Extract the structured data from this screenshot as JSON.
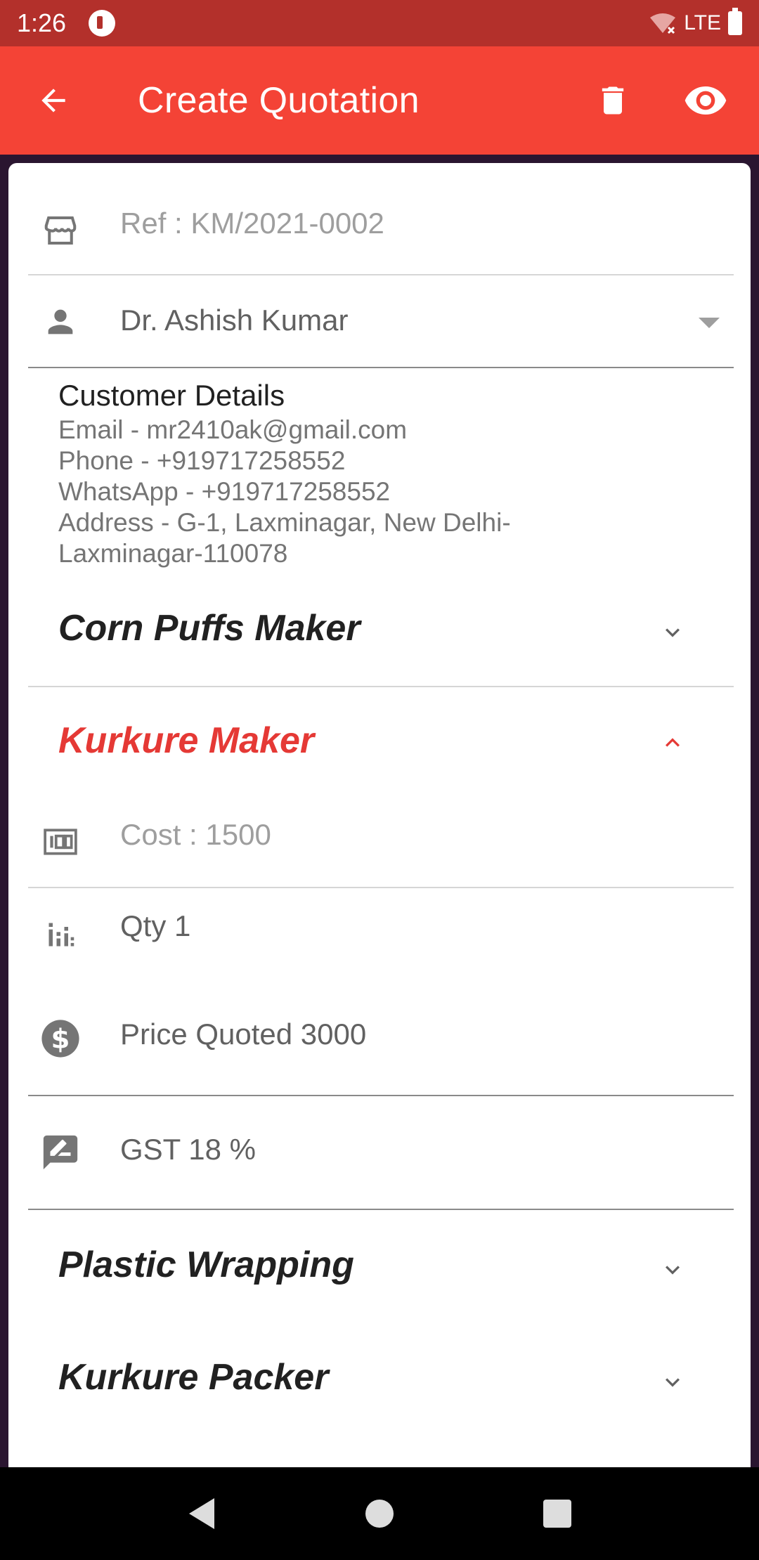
{
  "status_bar": {
    "time": "1:26",
    "network": "LTE"
  },
  "app_bar": {
    "title": "Create Quotation"
  },
  "form": {
    "ref": "Ref : KM/2021-0002",
    "customer_select": "Dr. Ashish Kumar"
  },
  "customer": {
    "title": "Customer Details",
    "email": "Email - mr2410ak@gmail.com",
    "phone": "Phone - +919717258552",
    "whatsapp": "WhatsApp - +919717258552",
    "address_line1": "Address - G-1, Laxminagar, New Delhi-",
    "address_line2": "Laxminagar-110078"
  },
  "items": [
    {
      "name": "Corn Puffs Maker",
      "expanded": false
    },
    {
      "name": "Kurkure Maker",
      "expanded": true,
      "cost": "Cost : 1500",
      "qty": "Qty 1",
      "price": "Price Quoted 3000",
      "gst": "GST  18 %"
    },
    {
      "name": "Plastic Wrapping",
      "expanded": false
    },
    {
      "name": "Kurkure Packer",
      "expanded": false
    }
  ],
  "colors": {
    "primary": "#f44336",
    "status_bar": "#b3302b",
    "active_text": "#e53935"
  }
}
